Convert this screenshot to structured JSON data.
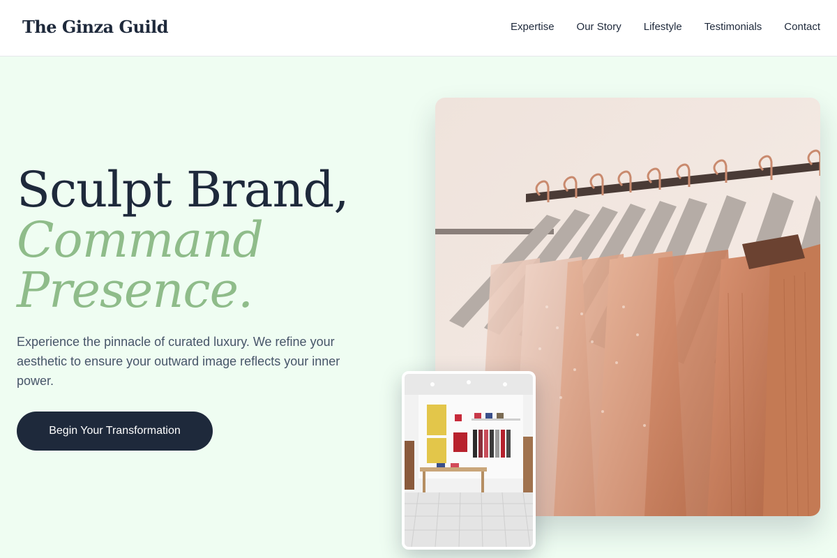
{
  "brand": {
    "name": "The Ginza Guild"
  },
  "nav": {
    "items": [
      {
        "label": "Expertise"
      },
      {
        "label": "Our Story"
      },
      {
        "label": "Lifestyle"
      },
      {
        "label": "Testimonials"
      },
      {
        "label": "Contact"
      }
    ]
  },
  "hero": {
    "headline_line1": "Sculpt Brand,",
    "headline_line2": "Command",
    "headline_line3": "Presence.",
    "subtext": "Experience the pinnacle of curated luxury. We refine your aesthetic to ensure your outward image reflects your inner power.",
    "cta_label": "Begin Your Transformation"
  },
  "colors": {
    "background": "#effdf2",
    "primary": "#1e293b",
    "accent": "#8fbc8a",
    "body_text": "#475569"
  },
  "images": {
    "main": "clothing-rack-photo",
    "inset": "boutique-interior-photo"
  }
}
